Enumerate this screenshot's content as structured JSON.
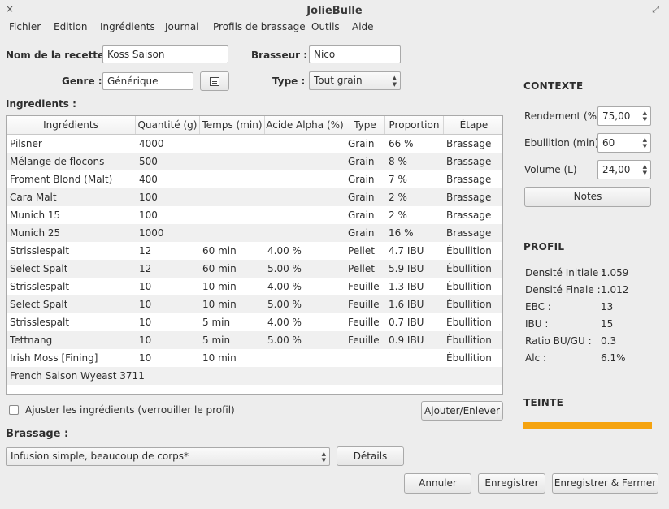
{
  "window": {
    "title": "JolieBulle",
    "close_glyph": "×",
    "maximize_glyph": "⤢"
  },
  "menu": [
    "Fichier",
    "Edition",
    "Ingrédients",
    "Journal",
    "Profils de brassage",
    "Outils",
    "Aide"
  ],
  "recipe": {
    "name_label": "Nom de la recette :",
    "name_value": "Koss Saison",
    "brewer_label": "Brasseur :",
    "brewer_value": "Nico",
    "genre_label": "Genre :",
    "genre_value": "Générique",
    "type_label": "Type :",
    "type_value": "Tout grain"
  },
  "ingredients": {
    "section_label": "Ingredients :",
    "headers": [
      "Ingrédients",
      "Quantité (g)",
      "Temps (min)",
      "Acide Alpha (%)",
      "Type",
      "Proportion",
      "Étape"
    ],
    "rows": [
      [
        "Pilsner",
        "4000",
        "",
        "",
        "Grain",
        "66 %",
        "Brassage"
      ],
      [
        "Mélange de flocons",
        "500",
        "",
        "",
        "Grain",
        "8 %",
        "Brassage"
      ],
      [
        "Froment Blond (Malt)",
        "400",
        "",
        "",
        "Grain",
        "7 %",
        "Brassage"
      ],
      [
        "Cara Malt",
        "100",
        "",
        "",
        "Grain",
        "2 %",
        "Brassage"
      ],
      [
        "Munich 15",
        "100",
        "",
        "",
        "Grain",
        "2 %",
        "Brassage"
      ],
      [
        "Munich 25",
        "1000",
        "",
        "",
        "Grain",
        "16 %",
        "Brassage"
      ],
      [
        "Strisslespalt",
        "12",
        "60 min",
        "4.00 %",
        "Pellet",
        "4.7 IBU",
        "Ébullition"
      ],
      [
        "Select Spalt",
        "12",
        "60 min",
        "5.00 %",
        "Pellet",
        "5.9 IBU",
        "Ébullition"
      ],
      [
        "Strisslespalt",
        "10",
        "10 min",
        "4.00 %",
        "Feuille",
        "1.3 IBU",
        "Ébullition"
      ],
      [
        "Select Spalt",
        "10",
        "10 min",
        "5.00 %",
        "Feuille",
        "1.6 IBU",
        "Ébullition"
      ],
      [
        "Strisslespalt",
        "10",
        "5 min",
        "4.00 %",
        "Feuille",
        "0.7 IBU",
        "Ébullition"
      ],
      [
        "Tettnang",
        "10",
        "5 min",
        "5.00 %",
        "Feuille",
        "0.9 IBU",
        "Ébullition"
      ],
      [
        "Irish Moss [Fining]",
        "10",
        "10 min",
        "",
        "",
        "",
        "Ébullition"
      ],
      [
        "French Saison Wyeast 3711",
        "",
        "",
        "",
        "",
        "",
        ""
      ]
    ],
    "lock_label": "Ajuster les ingrédients (verrouiller le profil)",
    "add_remove_button": "Ajouter/Enlever"
  },
  "brassage": {
    "label": "Brassage :",
    "profile_value": "Infusion simple, beaucoup de corps*",
    "details_button": "Détails"
  },
  "contexte": {
    "title": "CONTEXTE",
    "rendement_label": "Rendement (%)",
    "rendement_value": "75,00",
    "ebullition_label": "Ebullition (min)",
    "ebullition_value": "60",
    "volume_label": "Volume (L)",
    "volume_value": "24,00",
    "notes_button": "Notes"
  },
  "profil": {
    "title": "PROFIL",
    "items": [
      {
        "label": "Densité Initiale :",
        "value": "1.059"
      },
      {
        "label": "Densité Finale :",
        "value": "1.012"
      },
      {
        "label": "EBC :",
        "value": "13"
      },
      {
        "label": "IBU :",
        "value": "15"
      },
      {
        "label": "Ratio BU/GU :",
        "value": "0.3"
      },
      {
        "label": "Alc :",
        "value": "6.1%"
      }
    ]
  },
  "teinte": {
    "title": "TEINTE",
    "color": "#f5a30f"
  },
  "footer": {
    "cancel": "Annuler",
    "save": "Enregistrer",
    "save_close": "Enregistrer & Fermer"
  },
  "icons": {
    "notes": "list-icon",
    "spin_up": "▲",
    "spin_down": "▼"
  }
}
